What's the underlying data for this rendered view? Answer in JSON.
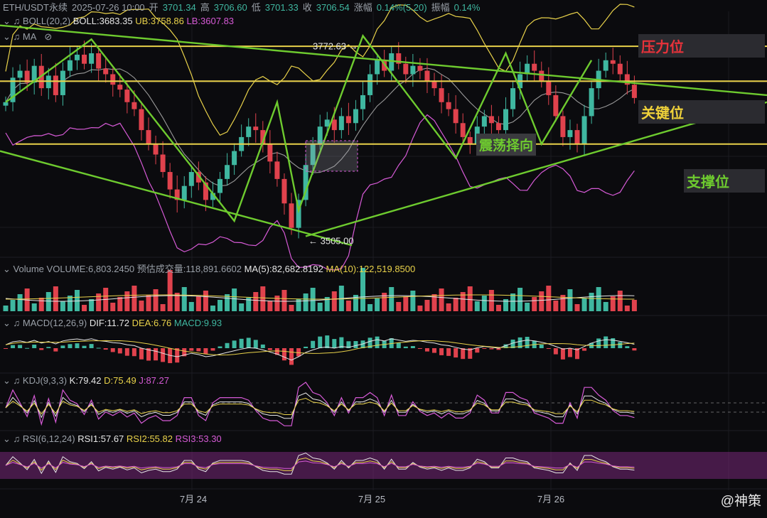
{
  "header": {
    "symbol": "ETH/USDT永续",
    "datetime": "2025-07-26 10:00",
    "open_label": "开",
    "open": "3701.34",
    "high_label": "高",
    "high": "3706.60",
    "low_label": "低",
    "low": "3701.33",
    "close_label": "收",
    "close": "3706.54",
    "change_label": "涨幅",
    "change": "0.14%(5.20)",
    "amp_label": "振幅",
    "amp": "0.14%"
  },
  "boll": {
    "name": "BOLL(20,2)",
    "mid_label": "BOLL:",
    "mid": "3683.35",
    "ub_label": "UB:",
    "ub": "3758.86",
    "lb_label": "LB:",
    "lb": "3607.83"
  },
  "ma": {
    "name": "MA"
  },
  "volume": {
    "name": "Volume",
    "vol_label": "VOLUME:",
    "vol": "6,803.2450",
    "est_label": "预估成交量:",
    "est": "118,891.6602",
    "ma5_label": "MA(5):",
    "ma5": "82,682.8192",
    "ma10_label": "MA(10):",
    "ma10": "122,519.8500"
  },
  "macd": {
    "name": "MACD(12,26,9)",
    "dif_label": "DIF:",
    "dif": "11.72",
    "dea_label": "DEA:",
    "dea": "6.76",
    "macd_label": "MACD:",
    "macd": "9.93"
  },
  "kdj": {
    "name": "KDJ(9,3,3)",
    "k_label": "K:",
    "k": "79.42",
    "d_label": "D:",
    "d": "75.49",
    "j_label": "J:",
    "j": "87.27"
  },
  "rsi": {
    "name": "RSI(6,12,24)",
    "r1_label": "RSI1:",
    "r1": "57.67",
    "r2_label": "RSI2:",
    "r2": "55.82",
    "r3_label": "RSI3:",
    "r3": "53.30"
  },
  "annotations": {
    "pressure": "压力位",
    "key": "关键位",
    "support": "支撑位",
    "range": "震荡择向",
    "high_mark": "3772.63",
    "low_mark": "3505.00"
  },
  "watermark": "@神策",
  "colors": {
    "up": "#3fb7a0",
    "down": "#e0424d",
    "yellow": "#e9d24a",
    "green": "#6ecb2f",
    "pink": "#d65ad6",
    "gray": "#9a9a9a"
  },
  "chart_data": {
    "type": "candlestick",
    "x_ticks": [
      "7月 24",
      "7月 25",
      "7月 26"
    ],
    "price_levels": {
      "pressure": 3780,
      "key": 3730,
      "support": 3640
    },
    "marked_high": 3772.63,
    "marked_low": 3505.0,
    "last": {
      "open": 3701.34,
      "high": 3706.6,
      "low": 3701.33,
      "close": 3706.54
    },
    "boll": {
      "mid": 3683.35,
      "ub": 3758.86,
      "lb": 3607.83
    },
    "close_series": [
      3700,
      3735,
      3745,
      3728,
      3752,
      3720,
      3738,
      3710,
      3745,
      3760,
      3768,
      3755,
      3770,
      3748,
      3740,
      3725,
      3718,
      3700,
      3690,
      3660,
      3640,
      3625,
      3600,
      3575,
      3560,
      3580,
      3600,
      3585,
      3560,
      3570,
      3590,
      3610,
      3630,
      3650,
      3665,
      3660,
      3640,
      3615,
      3590,
      3555,
      3520,
      3560,
      3610,
      3640,
      3665,
      3675,
      3660,
      3680,
      3670,
      3690,
      3710,
      3740,
      3760,
      3745,
      3770,
      3755,
      3740,
      3752,
      3745,
      3730,
      3720,
      3700,
      3690,
      3670,
      3650,
      3640,
      3665,
      3680,
      3670,
      3660,
      3690,
      3720,
      3740,
      3755,
      3745,
      3730,
      3710,
      3680,
      3650,
      3660,
      3640,
      3680,
      3720,
      3745,
      3760,
      3755,
      3740,
      3725,
      3706
    ]
  }
}
